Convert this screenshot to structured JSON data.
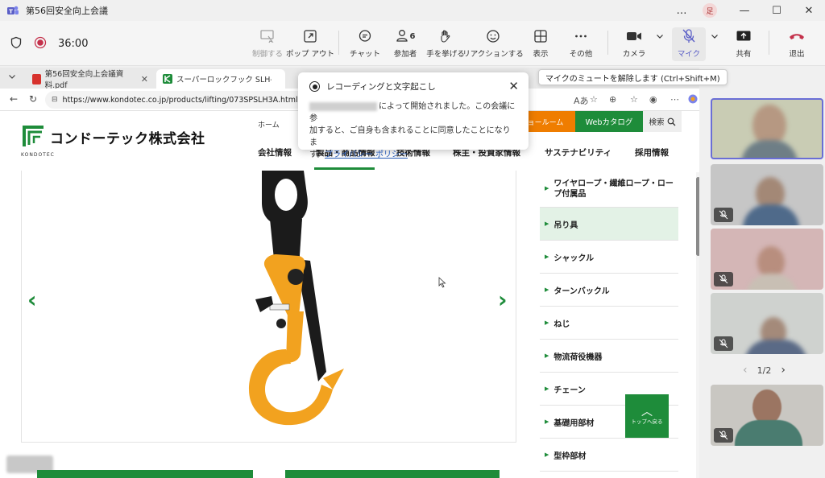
{
  "window": {
    "title": "第56回安全向上会議",
    "avatar_initial": "足",
    "more": "…",
    "minimize": "—",
    "maximize": "☐",
    "close": "✕"
  },
  "meeting": {
    "timer": "36:00",
    "toolbar": {
      "control": "制御する",
      "popout": "ポップ アウト",
      "chat": "チャット",
      "participants": "参加者",
      "participants_count": "6",
      "raise_hand": "手を挙げる",
      "reactions": "リアクションする",
      "view": "表示",
      "more": "その他",
      "camera": "カメラ",
      "mic": "マイク",
      "share": "共有",
      "leave": "退出"
    },
    "mic_tooltip": "マイクのミュートを解除します (Ctrl+Shift+M)"
  },
  "browser": {
    "tabs": [
      {
        "label": "第56回安全向上会議資料.pdf"
      },
      {
        "label": "スーパーロックフック SLH-A｜吊り具｜コ"
      }
    ],
    "url": "https://www.kondotec.co.jp/products/lifting/073SPSLH3A.html"
  },
  "recording_popup": {
    "title": "レコーディングと文字起こし",
    "body_1": "によって開始されました。この会議に参",
    "body_2": "加すると、ご自身も含まれることに同意したことになりま",
    "body_3": "す。",
    "link": "プライバシー ポリシー"
  },
  "site": {
    "company": "コンドーテック株式会社",
    "logo_sub": "KONDOTEC",
    "top_home": "ホーム",
    "showroom": "ョールーム",
    "web_catalog": "Webカタログ",
    "search": "検索",
    "nav": {
      "company_info": "会社情報",
      "products": "製品・商品情報",
      "tech": "技術情報",
      "investors": "株主・投資家情報",
      "sustainability": "サステナビリティ",
      "recruit": "採用情報"
    },
    "side_menu": [
      "ワイヤロープ・繊維ロープ・ロープ付属品",
      "吊り具",
      "シャックル",
      "ターンバックル",
      "ねじ",
      "物流荷役機器",
      "チェーン",
      "基礎用部材",
      "型枠部材"
    ],
    "back_to_top": "トップへ戻る",
    "carousel_prev": "‹",
    "carousel_next": "›"
  },
  "participants_panel": {
    "pager": "1/2",
    "prev": "‹",
    "next": "›"
  },
  "colors": {
    "kondotec_green": "#1e8c3a",
    "showroom_orange": "#ef7d00",
    "teams_accent": "#5b5fc7",
    "leave_red": "#c4314b",
    "hook_yellow": "#f2a21f"
  }
}
